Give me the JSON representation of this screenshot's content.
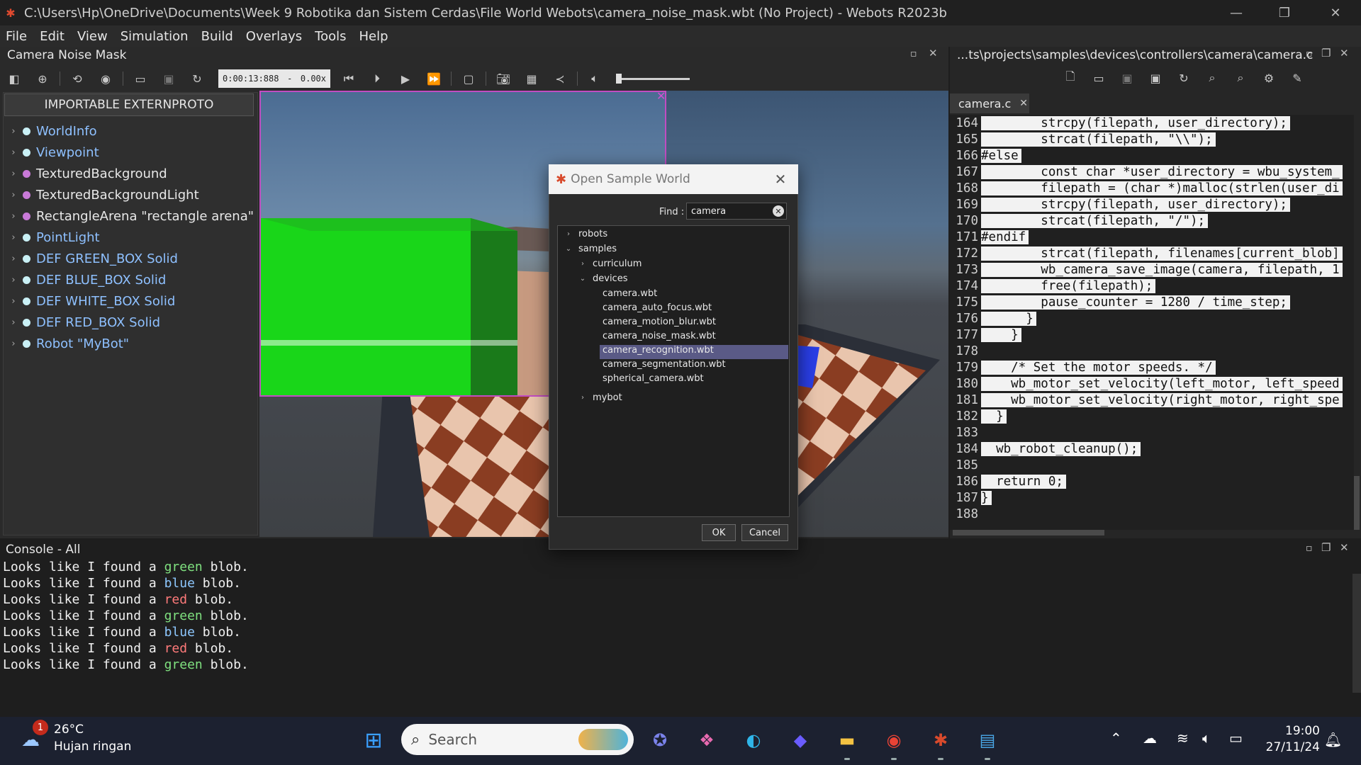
{
  "window": {
    "title": "C:\\Users\\Hp\\OneDrive\\Documents\\Week 9 Robotika dan Sistem Cerdas\\File World Webots\\camera_noise_mask.wbt (No Project) - Webots R2023b"
  },
  "menubar": [
    "File",
    "Edit",
    "View",
    "Simulation",
    "Build",
    "Overlays",
    "Tools",
    "Help"
  ],
  "world": {
    "title": "Camera Noise Mask",
    "time": "0:00:13:888",
    "speed_sep": "-",
    "speed": "0.00x"
  },
  "scene_tree": {
    "proto_button": "IMPORTABLE EXTERNPROTO",
    "nodes": [
      {
        "label": "WorldInfo",
        "color": "#8ec0ff",
        "dot": "#c9f0f5"
      },
      {
        "label": "Viewpoint",
        "color": "#8ec0ff",
        "dot": "#c9f0f5"
      },
      {
        "label": "TexturedBackground",
        "color": "#e8e8e8",
        "dot": "#c97ad8"
      },
      {
        "label": "TexturedBackgroundLight",
        "color": "#e8e8e8",
        "dot": "#c97ad8"
      },
      {
        "label": "RectangleArena \"rectangle arena\"",
        "color": "#e8e8e8",
        "dot": "#c97ad8"
      },
      {
        "label": "PointLight",
        "color": "#8ec0ff",
        "dot": "#c9f0f5"
      },
      {
        "label": "DEF GREEN_BOX Solid",
        "color": "#8ec0ff",
        "dot": "#c9f0f5"
      },
      {
        "label": "DEF BLUE_BOX Solid",
        "color": "#8ec0ff",
        "dot": "#c9f0f5"
      },
      {
        "label": "DEF WHITE_BOX Solid",
        "color": "#8ec0ff",
        "dot": "#c9f0f5"
      },
      {
        "label": "DEF RED_BOX Solid",
        "color": "#8ec0ff",
        "dot": "#c9f0f5"
      },
      {
        "label": "Robot \"MyBot\"",
        "color": "#8ec0ff",
        "dot": "#c9f0f5"
      }
    ]
  },
  "editor": {
    "path": "...ts\\projects\\samples\\devices\\controllers\\camera\\camera.c",
    "tab": "camera.c",
    "lines": [
      {
        "n": "164",
        "code": "        strcpy(filepath, user_directory);"
      },
      {
        "n": "165",
        "code": "        strcat(filepath, \"\\\\\");"
      },
      {
        "n": "166",
        "code": "#else"
      },
      {
        "n": "167",
        "code": "        const char *user_directory = wbu_system_"
      },
      {
        "n": "168",
        "code": "        filepath = (char *)malloc(strlen(user_di"
      },
      {
        "n": "169",
        "code": "        strcpy(filepath, user_directory);"
      },
      {
        "n": "170",
        "code": "        strcat(filepath, \"/\");"
      },
      {
        "n": "171",
        "code": "#endif"
      },
      {
        "n": "172",
        "code": "        strcat(filepath, filenames[current_blob]"
      },
      {
        "n": "173",
        "code": "        wb_camera_save_image(camera, filepath, 1"
      },
      {
        "n": "174",
        "code": "        free(filepath);"
      },
      {
        "n": "175",
        "code": "        pause_counter = 1280 / time_step;"
      },
      {
        "n": "176",
        "code": "      }"
      },
      {
        "n": "177",
        "code": "    }"
      },
      {
        "n": "178",
        "code": ""
      },
      {
        "n": "179",
        "code": "    /* Set the motor speeds. */"
      },
      {
        "n": "180",
        "code": "    wb_motor_set_velocity(left_motor, left_speed"
      },
      {
        "n": "181",
        "code": "    wb_motor_set_velocity(right_motor, right_spe"
      },
      {
        "n": "182",
        "code": "  }"
      },
      {
        "n": "183",
        "code": ""
      },
      {
        "n": "184",
        "code": "  wb_robot_cleanup();"
      },
      {
        "n": "185",
        "code": ""
      },
      {
        "n": "186",
        "code": "  return 0;"
      },
      {
        "n": "187",
        "code": "}"
      },
      {
        "n": "188",
        "code": ""
      }
    ]
  },
  "console": {
    "title": "Console - All",
    "prefix": "Looks like I found a ",
    "suffix": " blob.",
    "lines": [
      {
        "color_word": "green",
        "color": "#7fe07f"
      },
      {
        "color_word": "blue",
        "color": "#8ec8ff"
      },
      {
        "color_word": "red",
        "color": "#ff7a7a"
      },
      {
        "color_word": "green",
        "color": "#7fe07f"
      },
      {
        "color_word": "blue",
        "color": "#8ec8ff"
      },
      {
        "color_word": "red",
        "color": "#ff7a7a"
      },
      {
        "color_word": "green",
        "color": "#7fe07f"
      }
    ]
  },
  "dialog": {
    "title": "Open Sample World",
    "find_label": "Find :",
    "find_value": "camera",
    "tree": {
      "robots": "robots",
      "samples": "samples",
      "curriculum": "curriculum",
      "devices": "devices",
      "files": [
        "camera.wbt",
        "camera_auto_focus.wbt",
        "camera_motion_blur.wbt",
        "camera_noise_mask.wbt",
        "camera_recognition.wbt",
        "camera_segmentation.wbt",
        "spherical_camera.wbt"
      ],
      "selected": "camera_recognition.wbt",
      "mybot": "mybot"
    },
    "ok": "OK",
    "cancel": "Cancel"
  },
  "taskbar": {
    "weather_badge": "1",
    "temperature": "26°C",
    "weather": "Hujan ringan",
    "search": "Search",
    "time": "19:00",
    "date": "27/11/24"
  },
  "colors": {
    "selection": "#5a5a86",
    "overlay_border": "#c24cc2",
    "green_box": "#19d619"
  }
}
